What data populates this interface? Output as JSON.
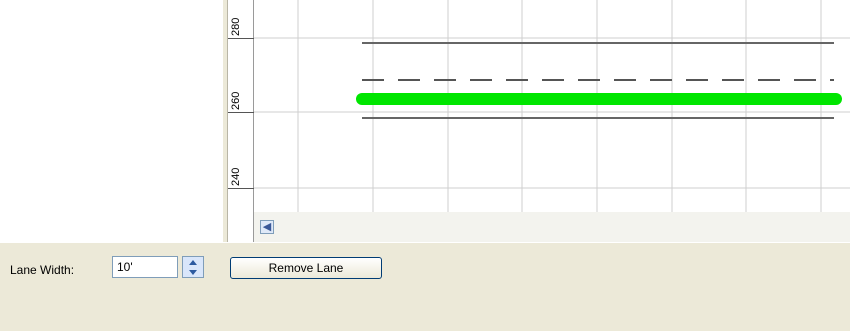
{
  "ruler": {
    "ticks": [
      "280",
      "260",
      "240"
    ]
  },
  "controls": {
    "lane_width_label": "Lane Width:",
    "lane_width_value": "10'",
    "remove_lane_label": "Remove Lane"
  },
  "colors": {
    "lane_highlight": "#00e600",
    "panel_bg": "#ece9d8"
  }
}
